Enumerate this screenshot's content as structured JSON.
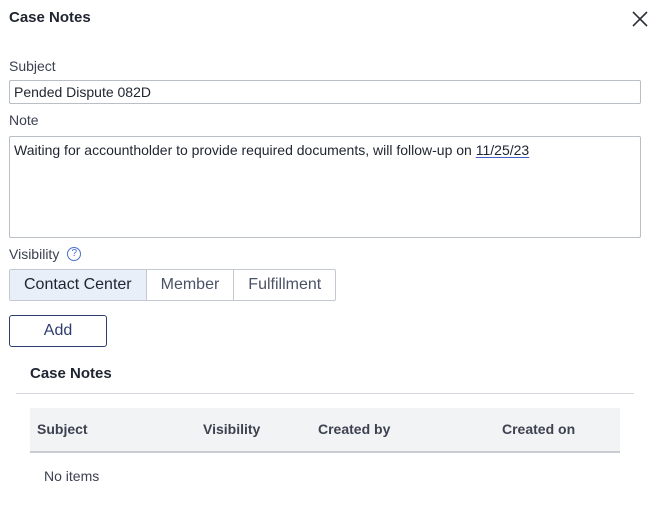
{
  "dialog": {
    "title": "Case Notes"
  },
  "form": {
    "subject_label": "Subject",
    "subject_value": "Pended Dispute 082D",
    "note_label": "Note",
    "note_text": "Waiting for accountholder to provide required documents, will follow-up on ",
    "note_date": "11/25/23",
    "visibility_label": "Visibility",
    "help_glyph": "?",
    "visibility_options": [
      "Contact Center",
      "Member",
      "Fulfillment"
    ],
    "visibility_selected": "Contact Center",
    "add_label": "Add"
  },
  "notes_table": {
    "title": "Case Notes",
    "columns": [
      "Subject",
      "Visibility",
      "Created by",
      "Created on"
    ],
    "empty_text": "No items"
  },
  "icons": {
    "close": "close-icon",
    "help": "help-circle-icon"
  },
  "colors": {
    "accent": "#2d3d6e",
    "selected_bg": "#e9eff9",
    "header_bg": "#f2f3f5"
  }
}
